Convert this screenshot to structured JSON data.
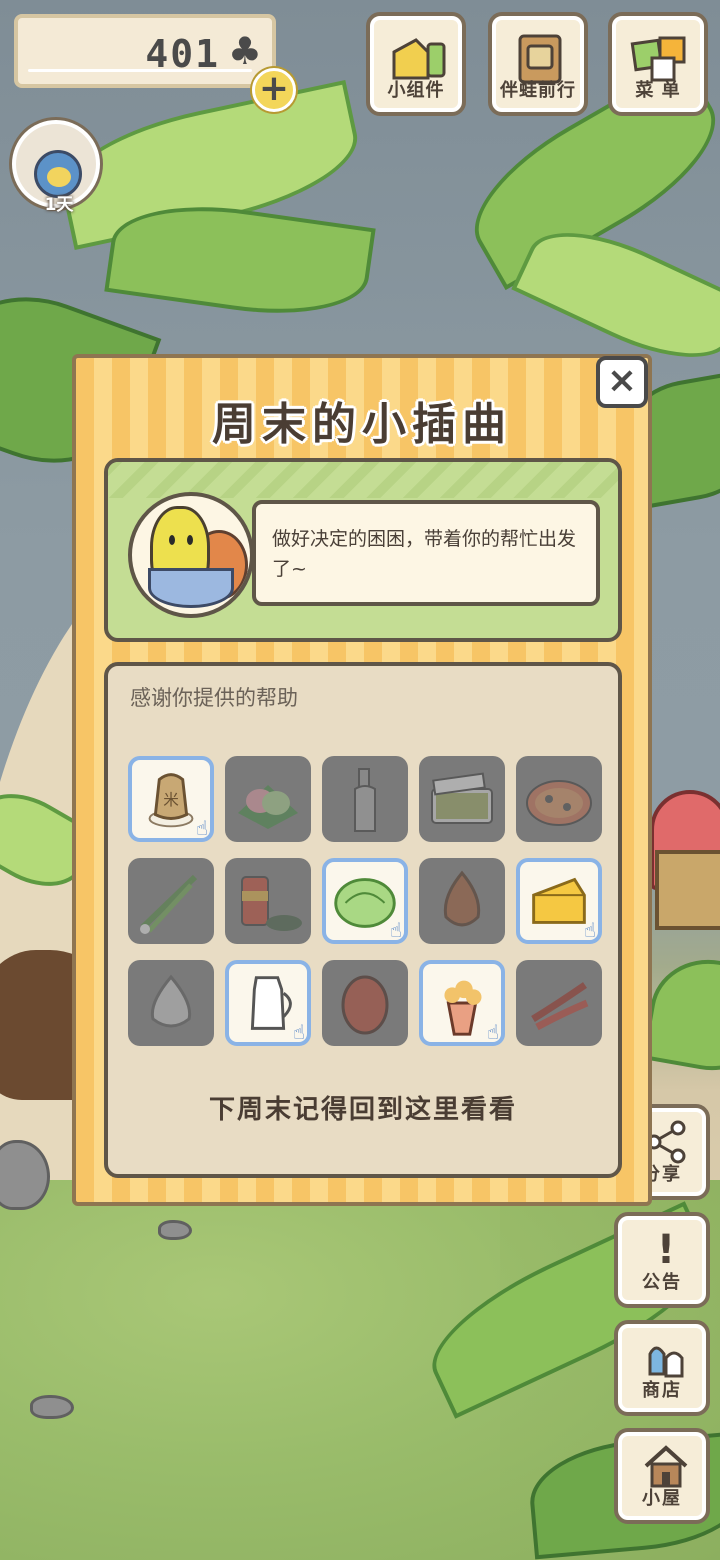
{
  "currency": {
    "value": "401",
    "icon": "clover-icon",
    "add_icon": "plus-icon"
  },
  "top_buttons": [
    {
      "label": "小组件",
      "icon": "widget-icon"
    },
    {
      "label": "伴蛙前行",
      "icon": "travel-book-icon"
    },
    {
      "label": "菜 单",
      "icon": "menu-cards-icon"
    }
  ],
  "avatar": {
    "day_label": "1天"
  },
  "modal": {
    "title": "周末的小插曲",
    "close_icon": "×",
    "story": {
      "text": "做好决定的困困，带着你的帮忙出发了~"
    },
    "help_heading": "感谢你提供的帮助",
    "items": [
      {
        "name": "rice-bag",
        "owned": true
      },
      {
        "name": "rice-cake",
        "owned": false
      },
      {
        "name": "bottle",
        "owned": false
      },
      {
        "name": "bento-box",
        "owned": false
      },
      {
        "name": "pizza",
        "owned": false
      },
      {
        "name": "green-onion",
        "owned": false
      },
      {
        "name": "canned-food",
        "owned": false
      },
      {
        "name": "cabbage",
        "owned": true
      },
      {
        "name": "onion",
        "owned": false
      },
      {
        "name": "cheese",
        "owned": true
      },
      {
        "name": "garlic",
        "owned": false
      },
      {
        "name": "milk-jug",
        "owned": true
      },
      {
        "name": "mango",
        "owned": false
      },
      {
        "name": "popcorn",
        "owned": true
      },
      {
        "name": "chili-pepper",
        "owned": false
      }
    ],
    "footer": "下周末记得回到这里看看"
  },
  "side_buttons": [
    {
      "label": "分享",
      "icon": "share-icon"
    },
    {
      "label": "公告",
      "icon": "notice-icon"
    },
    {
      "label": "商店",
      "icon": "shop-icon"
    },
    {
      "label": "小屋",
      "icon": "house-icon"
    }
  ],
  "colors": {
    "modal_stripe_a": "#f7c566",
    "modal_stripe_b": "#fbd98a",
    "owned_border": "#8ab3e6",
    "locked_bg": "#7a7a7a"
  }
}
